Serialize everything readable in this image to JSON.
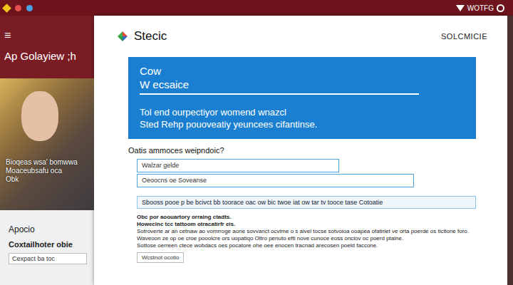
{
  "browser": {
    "status": "WOTFG"
  },
  "sidebar": {
    "menu": "≡",
    "title": "Ap Golayiew ;h",
    "photo_caption": [
      "Bioqeas wsa' bomwwa",
      "Moaceubsafu oca",
      "Obk"
    ],
    "heading": "Apocio",
    "subheading": "Coxtailhoter obie",
    "field": "Cexpact ba toc"
  },
  "card": {
    "brand": "Stecic",
    "link": "SOLCMICIE",
    "banner": {
      "title": "Cow",
      "subtitle": "W ecsaice",
      "lines": [
        "Tol end ourpectiyor womend wnazcl",
        "Sted Rehp pouoveatiy yeuncees cifantinse."
      ]
    },
    "question": "Oatis ammoces weipndoic?",
    "fields": [
      {
        "value": "Walzar gelde"
      },
      {
        "value": "Oeoocns oe Soveanse"
      }
    ],
    "notice": "Sbooss pooe p be bcivct bb toorace oac ow bic twoe iat ow tar tv tooce tase Cotoatie",
    "paragraphs": [
      "Obc por aoouartory orraing ctadts.",
      "Howecinc tcc tattoom otracatirfr eis.",
      "Sotroverte ar an cetnaw ao vomrroge aone sovvanct ocvlme o s aivel tocse sotvoioa ooapea ofatiriet ve orta poerde os tictlone foro.",
      "Waveoon ze op oe croe pooolcre ors uopatiqo Oltro penuto eftl nove cunoce eoss onciov oc poerd ptaine.",
      "Sottose oerreen ctece wobdacs oes pocatore ohe oee enocen tracnad arecosen poeld faccone."
    ],
    "button": "Wcstnot ocotio"
  }
}
